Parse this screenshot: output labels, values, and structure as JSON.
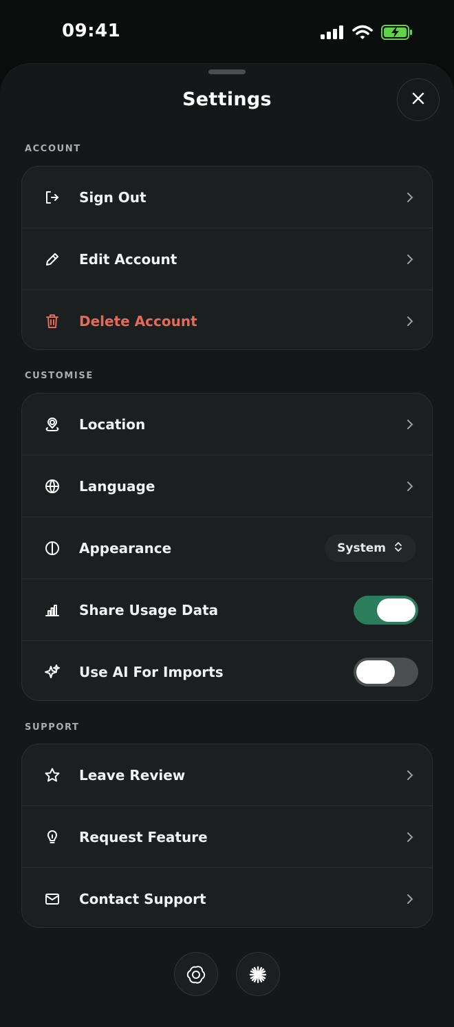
{
  "status_bar": {
    "time": "09:41",
    "icons": [
      "cellular-signal-icon",
      "wifi-icon",
      "battery-charging-icon"
    ],
    "battery_color": "#5fd34a"
  },
  "sheet": {
    "title": "Settings",
    "close_icon": "close-icon"
  },
  "sections": {
    "account": {
      "header": "ACCOUNT",
      "items": [
        {
          "label": "Sign Out",
          "icon": "sign-out-icon"
        },
        {
          "label": "Edit Account",
          "icon": "pencil-icon"
        },
        {
          "label": "Delete Account",
          "icon": "trash-icon",
          "color": "#e56a5a"
        }
      ]
    },
    "customise": {
      "header": "CUSTOMISE",
      "items": [
        {
          "label": "Location",
          "icon": "location-pin-icon"
        },
        {
          "label": "Language",
          "icon": "globe-icon"
        },
        {
          "label": "Appearance",
          "icon": "contrast-icon",
          "value": "System"
        },
        {
          "label": "Share Usage Data",
          "icon": "bar-chart-icon",
          "toggle": true
        },
        {
          "label": "Use AI For Imports",
          "icon": "sparkle-icon",
          "toggle": false
        }
      ]
    },
    "support": {
      "header": "SUPPORT",
      "items": [
        {
          "label": "Leave Review",
          "icon": "star-icon"
        },
        {
          "label": "Request Feature",
          "icon": "lightbulb-icon"
        },
        {
          "label": "Contact Support",
          "icon": "mail-icon"
        }
      ]
    }
  },
  "colors": {
    "accent_toggle_on": "#2b7d5d",
    "danger": "#e56a5a",
    "background": "#151818"
  },
  "bottom_buttons": [
    "openai-logo-icon",
    "claude-logo-icon"
  ]
}
